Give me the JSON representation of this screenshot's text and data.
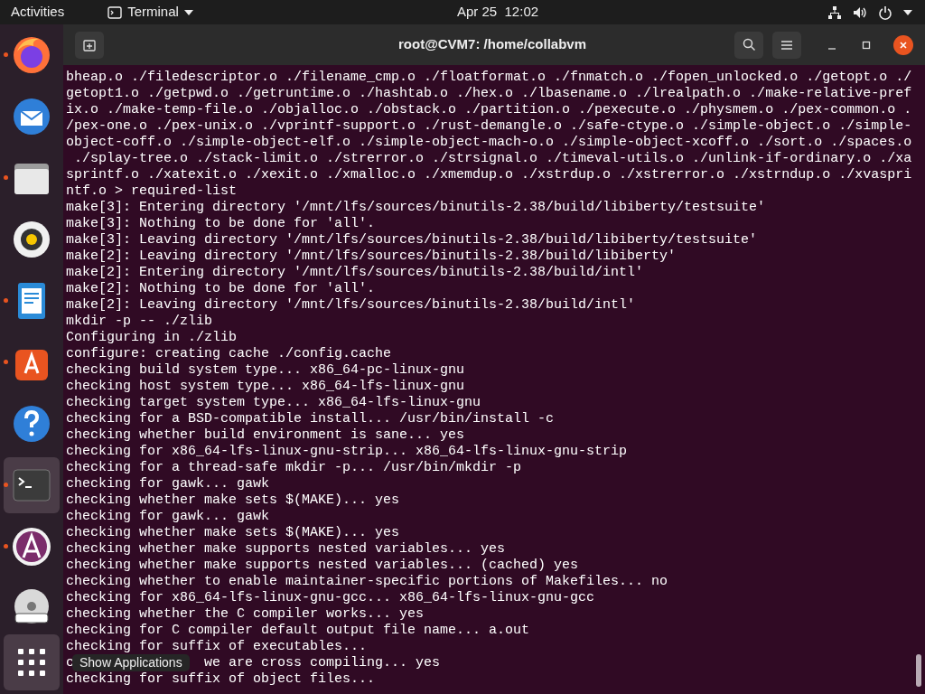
{
  "top_bar": {
    "activities": "Activities",
    "app_menu": "Terminal",
    "clock": "Apr 25  12:02"
  },
  "dock": {
    "items": [
      {
        "kind": "browser",
        "running": true,
        "selected": false
      },
      {
        "kind": "mail",
        "running": false,
        "selected": false
      },
      {
        "kind": "files",
        "running": true,
        "selected": false
      },
      {
        "kind": "music",
        "running": false,
        "selected": false
      },
      {
        "kind": "writer",
        "running": true,
        "selected": false
      },
      {
        "kind": "software",
        "running": true,
        "selected": false
      },
      {
        "kind": "help",
        "running": false,
        "selected": false
      },
      {
        "kind": "terminal",
        "running": true,
        "selected": true
      },
      {
        "kind": "app",
        "running": true,
        "selected": false
      },
      {
        "kind": "disc",
        "running": false,
        "selected": false
      }
    ],
    "show_applications": {
      "hovered": true,
      "tooltip": "Show Applications"
    }
  },
  "window": {
    "title": "root@CVM7: /home/collabvm"
  },
  "terminal": {
    "lines": [
      "bheap.o ./filedescriptor.o ./filename_cmp.o ./floatformat.o ./fnmatch.o ./fopen_unlocked.o ./getopt.o ./",
      "getopt1.o ./getpwd.o ./getruntime.o ./hashtab.o ./hex.o ./lbasename.o ./lrealpath.o ./make-relative-pref",
      "ix.o ./make-temp-file.o ./objalloc.o ./obstack.o ./partition.o ./pexecute.o ./physmem.o ./pex-common.o .",
      "/pex-one.o ./pex-unix.o ./vprintf-support.o ./rust-demangle.o ./safe-ctype.o ./simple-object.o ./simple-",
      "object-coff.o ./simple-object-elf.o ./simple-object-mach-o.o ./simple-object-xcoff.o ./sort.o ./spaces.o",
      " ./splay-tree.o ./stack-limit.o ./strerror.o ./strsignal.o ./timeval-utils.o ./unlink-if-ordinary.o ./xa",
      "sprintf.o ./xatexit.o ./xexit.o ./xmalloc.o ./xmemdup.o ./xstrdup.o ./xstrerror.o ./xstrndup.o ./xvaspri",
      "ntf.o > required-list",
      "make[3]: Entering directory '/mnt/lfs/sources/binutils-2.38/build/libiberty/testsuite'",
      "make[3]: Nothing to be done for 'all'.",
      "make[3]: Leaving directory '/mnt/lfs/sources/binutils-2.38/build/libiberty/testsuite'",
      "make[2]: Leaving directory '/mnt/lfs/sources/binutils-2.38/build/libiberty'",
      "make[2]: Entering directory '/mnt/lfs/sources/binutils-2.38/build/intl'",
      "make[2]: Nothing to be done for 'all'.",
      "make[2]: Leaving directory '/mnt/lfs/sources/binutils-2.38/build/intl'",
      "mkdir -p -- ./zlib",
      "Configuring in ./zlib",
      "configure: creating cache ./config.cache",
      "checking build system type... x86_64-pc-linux-gnu",
      "checking host system type... x86_64-lfs-linux-gnu",
      "checking target system type... x86_64-lfs-linux-gnu",
      "checking for a BSD-compatible install... /usr/bin/install -c",
      "checking whether build environment is sane... yes",
      "checking for x86_64-lfs-linux-gnu-strip... x86_64-lfs-linux-gnu-strip",
      "checking for a thread-safe mkdir -p... /usr/bin/mkdir -p",
      "checking for gawk... gawk",
      "checking whether make sets $(MAKE)... yes",
      "checking for gawk... gawk",
      "checking whether make sets $(MAKE)... yes",
      "checking whether make supports nested variables... yes",
      "checking whether make supports nested variables... (cached) yes",
      "checking whether to enable maintainer-specific portions of Makefiles... no",
      "checking for x86_64-lfs-linux-gnu-gcc... x86_64-lfs-linux-gnu-gcc",
      "checking whether the C compiler works... yes",
      "checking for C compiler default output file name... a.out",
      "checking for suffix of executables...",
      [
        "c",
        "we are cross compiling... yes"
      ],
      "checking for suffix of object files..."
    ]
  }
}
